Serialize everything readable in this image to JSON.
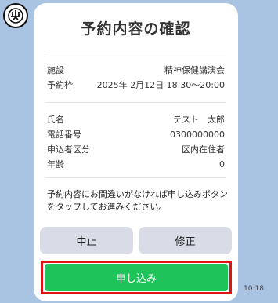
{
  "avatar_icon": "crest-logo-icon",
  "card": {
    "title": "予約内容の確認",
    "facility_label": "施設",
    "facility_value": "精神保健講演会",
    "slot_label": "予約枠",
    "slot_value": "2025年 2月12日 18:30～20:00",
    "name_label": "氏名",
    "name_value": "テスト　太郎",
    "phone_label": "電話番号",
    "phone_value": "0300000000",
    "category_label": "申込者区分",
    "category_value": "区内在住者",
    "age_label": "年齢",
    "age_value": "0",
    "note": "予約内容にお間違いがなければ申し込みボタンをタップしてお進みください。"
  },
  "buttons": {
    "cancel": "中止",
    "edit": "修正",
    "apply": "申し込み"
  },
  "timestamp": "10:18",
  "colors": {
    "background": "#a9c3e3",
    "apply": "#1ec35a",
    "highlight": "#e01414",
    "secondary_button": "#d9dce6"
  }
}
